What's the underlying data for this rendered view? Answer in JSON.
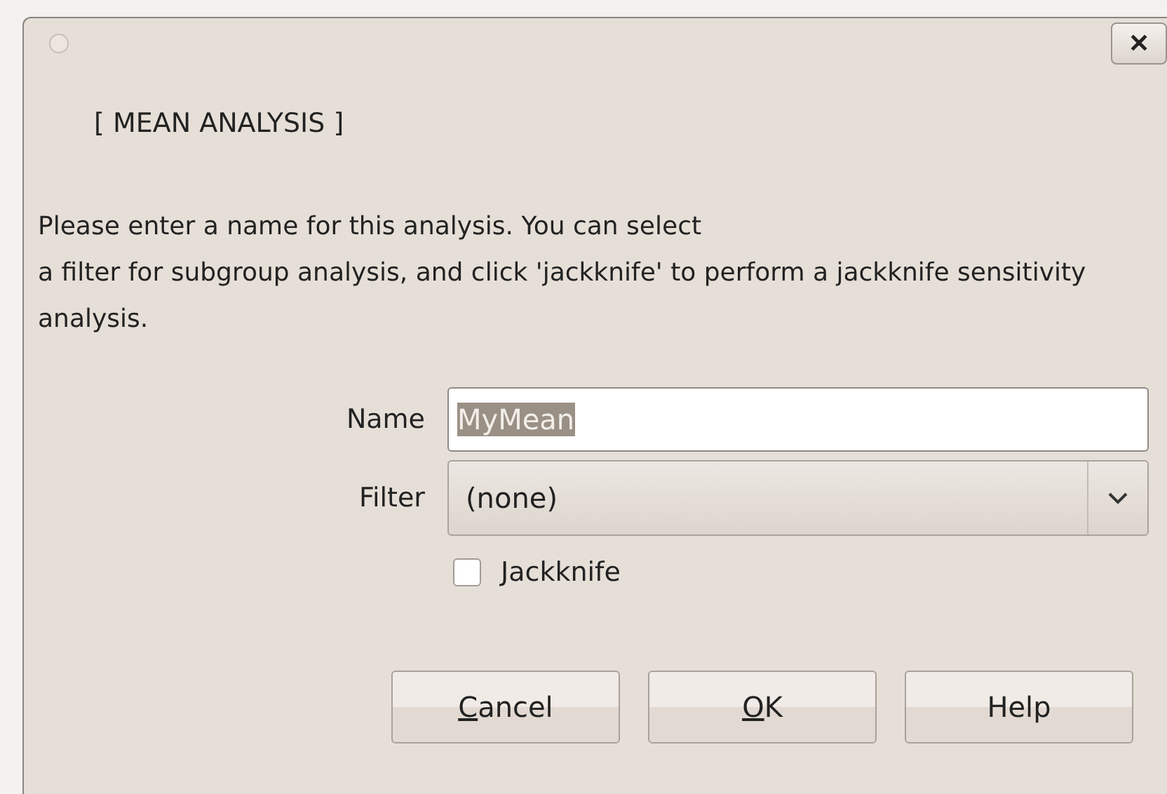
{
  "window": {
    "close_label": "✕"
  },
  "heading": "[ MEAN ANALYSIS ]",
  "description": "Please enter a name for this analysis. You can select\na filter for subgroup analysis, and click 'jackknife' to perform a jackknife sensitivity analysis.",
  "name_field": {
    "label": "Name",
    "value": "MyMean",
    "selected": true
  },
  "filter_field": {
    "label": "Filter",
    "value": "(none)"
  },
  "jackknife": {
    "label": "Jackknife",
    "checked": false
  },
  "buttons": [
    {
      "label": "Cancel",
      "underline_first": true
    },
    {
      "label": "OK",
      "underline_first": true
    },
    {
      "label": "Help",
      "underline_first": false
    }
  ]
}
